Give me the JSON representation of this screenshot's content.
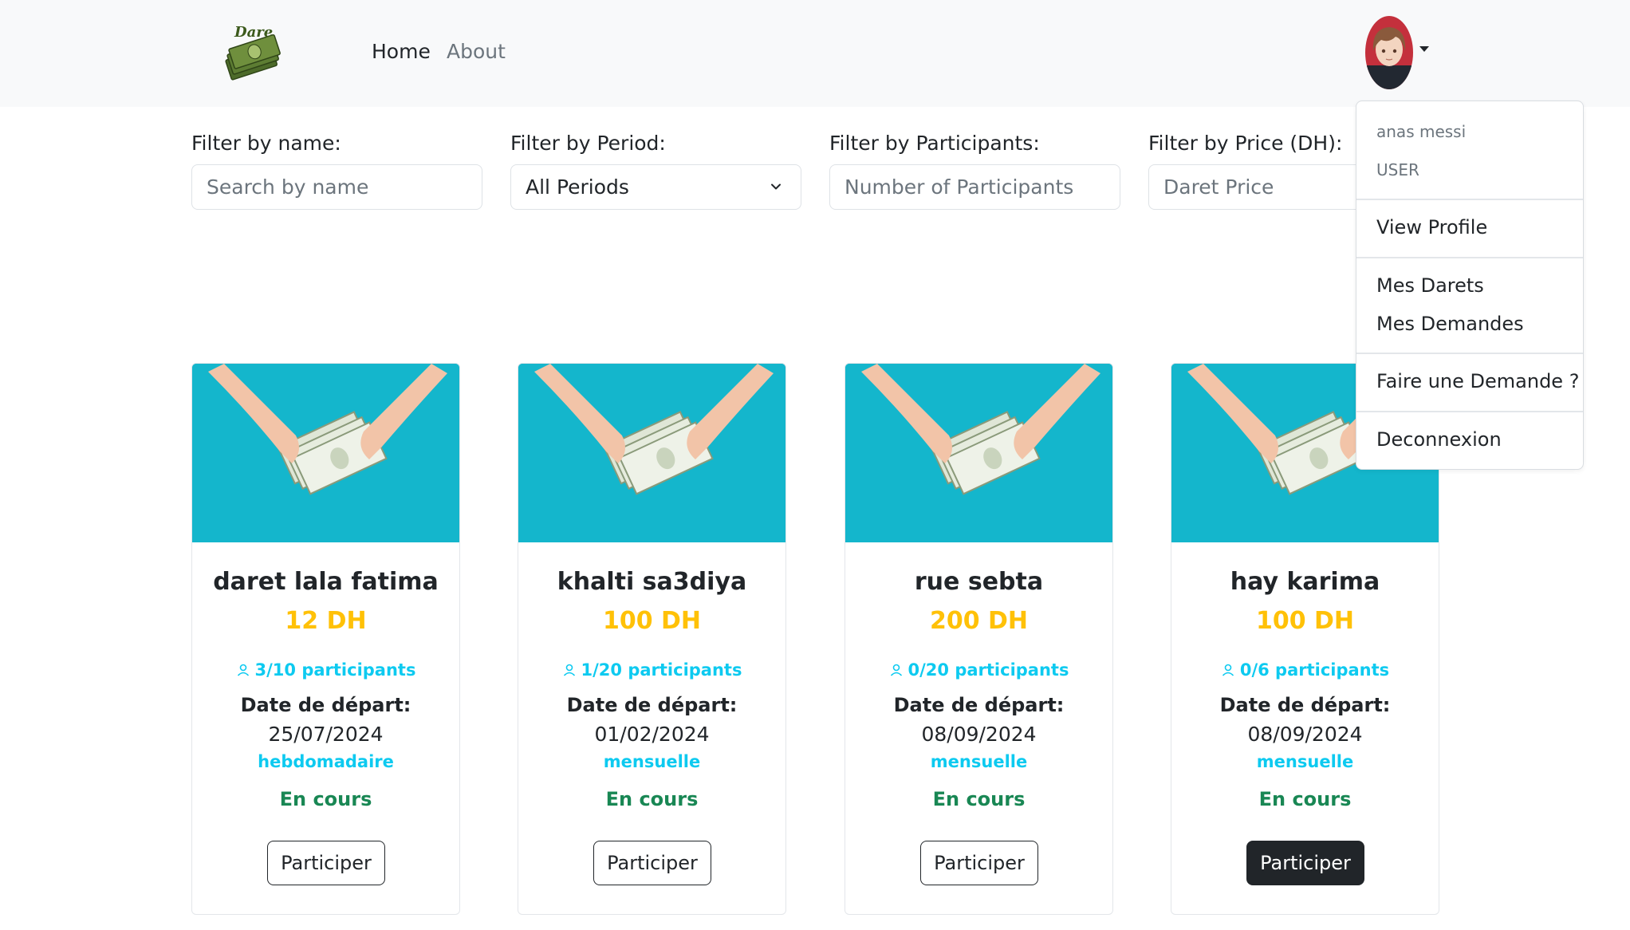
{
  "nav": {
    "home": "Home",
    "about": "About",
    "logo_text": "Dare"
  },
  "filters": {
    "name": {
      "label": "Filter by name:",
      "placeholder": "Search by name"
    },
    "period": {
      "label": "Filter by Period:",
      "selected": "All Periods"
    },
    "participants": {
      "label": "Filter by Participants:",
      "placeholder": "Number of Participants"
    },
    "price": {
      "label": "Filter by Price (DH):",
      "placeholder": "Daret Price"
    }
  },
  "cards": [
    {
      "title": "daret lala fatima",
      "price": "12 DH",
      "participants": "3/10 participants",
      "date_label": "Date de départ:",
      "date": "25/07/2024",
      "period": "hebdomadaire",
      "status": "En cours",
      "button": "Participer"
    },
    {
      "title": "khalti sa3diya",
      "price": "100 DH",
      "participants": "1/20 participants",
      "date_label": "Date de départ:",
      "date": "01/02/2024",
      "period": "mensuelle",
      "status": "En cours",
      "button": "Participer"
    },
    {
      "title": "rue sebta",
      "price": "200 DH",
      "participants": "0/20 participants",
      "date_label": "Date de départ:",
      "date": "08/09/2024",
      "period": "mensuelle",
      "status": "En cours",
      "button": "Participer"
    },
    {
      "title": "hay karima",
      "price": "100 DH",
      "participants": "0/6 participants",
      "date_label": "Date de départ:",
      "date": "08/09/2024",
      "period": "mensuelle",
      "status": "En cours",
      "button": "Participer"
    }
  ],
  "dropdown": {
    "username": "anas messi",
    "role": "USER",
    "view_profile": "View Profile",
    "mes_darets": "Mes Darets",
    "mes_demandes": "Mes Demandes",
    "faire_demande": "Faire une Demande ?",
    "deconnexion": "Deconnexion"
  },
  "colors": {
    "price": "#ffc107",
    "participants": "#0dcaf0",
    "status": "#198754",
    "card_image_bg": "#14b6cc",
    "navbar_bg": "#f8f9fa"
  }
}
